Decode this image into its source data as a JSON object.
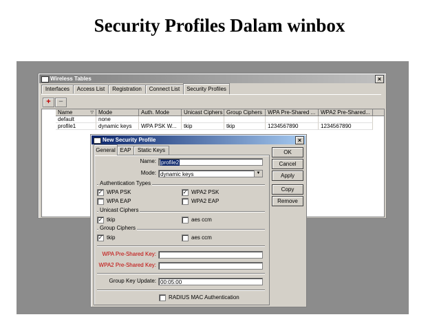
{
  "slide": {
    "title": "Security Profiles Dalam winbox"
  },
  "wireless_tables": {
    "title": "Wireless Tables",
    "close": "×",
    "tabs": [
      "Interfaces",
      "Access List",
      "Registration",
      "Connect List",
      "Security Profiles"
    ],
    "selected_tab": "Security Profiles",
    "toolbar": {
      "add": "+",
      "remove": "−"
    },
    "columns": [
      "Name",
      "Mode",
      "Auth. Mode",
      "Unicast Ciphers",
      "Group Ciphers",
      "WPA Pre-Shared ...",
      "WPA2 Pre-Shared..."
    ],
    "rows": [
      [
        "default",
        "none",
        "",
        "",
        "",
        "",
        ""
      ],
      [
        "profile1",
        "dynamic keys",
        "WPA PSK W...",
        "tkip",
        "tkip",
        "1234567890",
        "1234567890"
      ]
    ]
  },
  "dialog": {
    "title": "New Security Profile",
    "close": "×",
    "tabs": [
      "General",
      "EAP",
      "Static Keys"
    ],
    "buttons": {
      "ok": "OK",
      "cancel": "Cancel",
      "apply": "Apply",
      "copy": "Copy",
      "remove": "Remove"
    },
    "name_label": "Name:",
    "name_value": "profile2",
    "mode_label": "Mode:",
    "mode_value": "dynamic keys",
    "auth_types_title": "Authentication Types",
    "wpa_psk": {
      "label": "WPA PSK",
      "checked": true,
      "mark": "✓"
    },
    "wpa2_psk": {
      "label": "WPA2 PSK",
      "checked": true,
      "mark": "✓"
    },
    "wpa_eap": {
      "label": "WPA EAP",
      "checked": false,
      "mark": ""
    },
    "wpa2_eap": {
      "label": "WPA2 EAP",
      "checked": false,
      "mark": ""
    },
    "unicast_title": "Unicast Ciphers",
    "uc_tkip": {
      "label": "tkip",
      "checked": true,
      "mark": "✓"
    },
    "uc_aes": {
      "label": "aes ccm",
      "checked": false,
      "mark": ""
    },
    "group_title": "Group Ciphers",
    "gc_tkip": {
      "label": "tkip",
      "checked": true,
      "mark": "✓"
    },
    "gc_aes": {
      "label": "aes ccm",
      "checked": false,
      "mark": ""
    },
    "wpa_key_label": "WPA Pre-Shared Key:",
    "wpa_key_value": "",
    "wpa2_key_label": "WPA2 Pre-Shared Key:",
    "wpa2_key_value": "",
    "gku_label": "Group Key Update:",
    "gku_value": "00:05:00",
    "radius": {
      "label": "RADIUS MAC Authentication",
      "checked": false,
      "mark": ""
    }
  }
}
